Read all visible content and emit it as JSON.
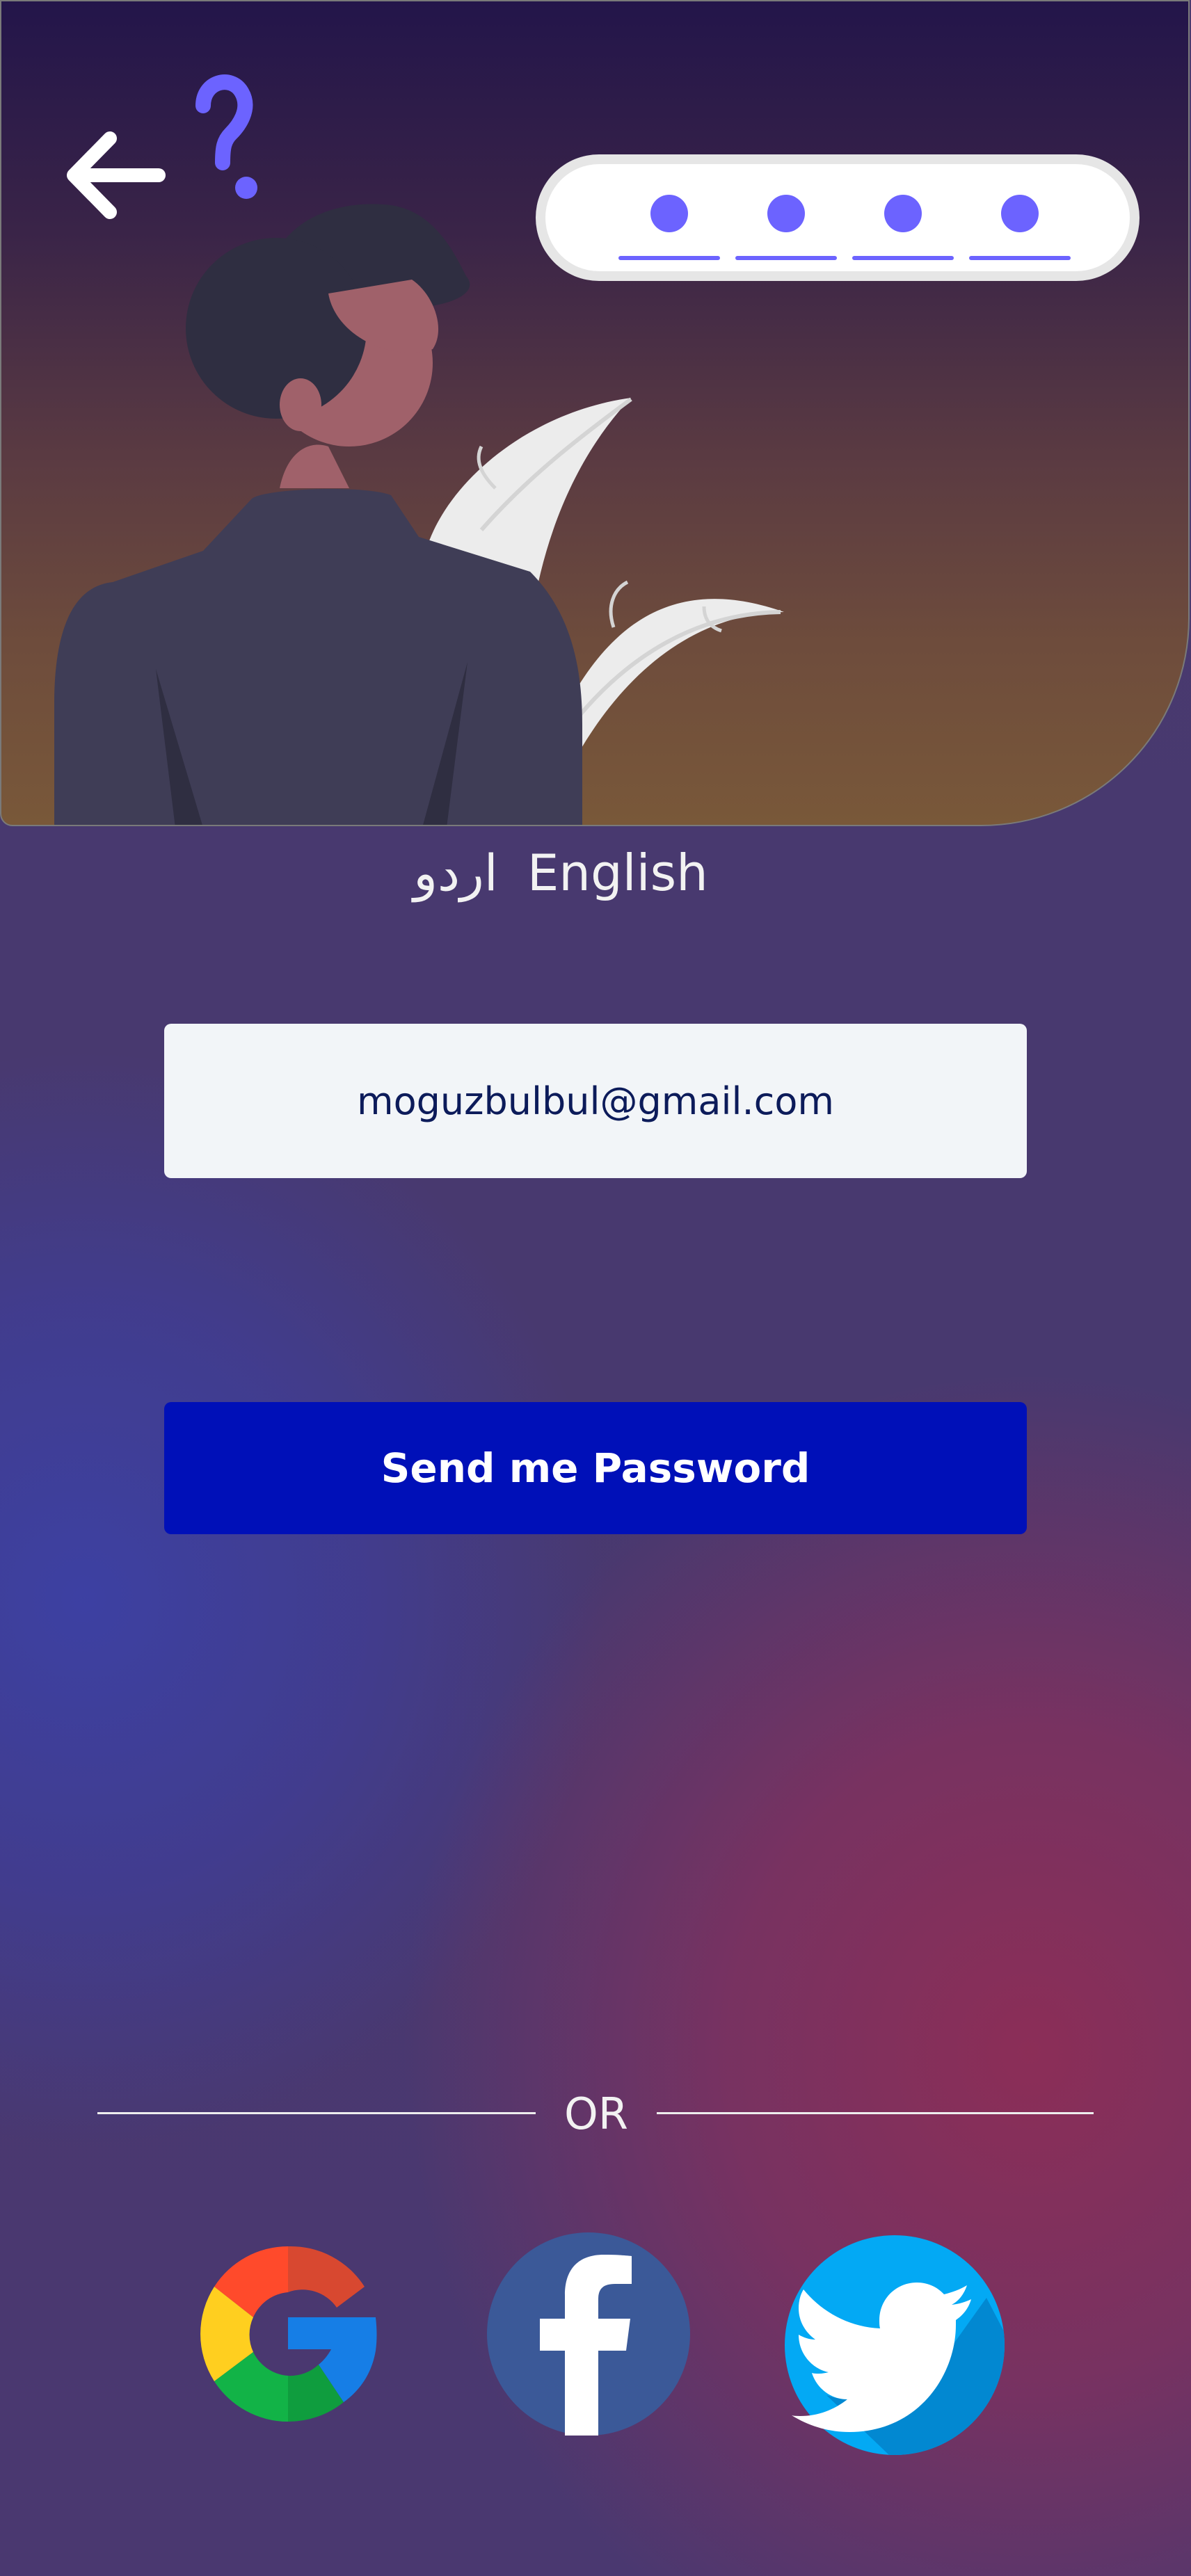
{
  "colors": {
    "accent": "#6c63ff",
    "button": "#0010b8",
    "field_background": "#f2f5f8",
    "field_text": "#0c1b5a"
  },
  "header": {
    "back_icon": "arrow-left-icon",
    "illustration": "person-question-mark-illustration",
    "pin_digits": 4
  },
  "language": {
    "urdu_label": "اردو",
    "english_label": "English"
  },
  "form": {
    "email_value": "moguzbulbul@gmail.com",
    "submit_label": "Send me Password"
  },
  "divider": {
    "label": "OR"
  },
  "social": [
    {
      "name": "google",
      "icon": "google-icon"
    },
    {
      "name": "facebook",
      "icon": "facebook-icon"
    },
    {
      "name": "twitter",
      "icon": "twitter-icon"
    }
  ]
}
